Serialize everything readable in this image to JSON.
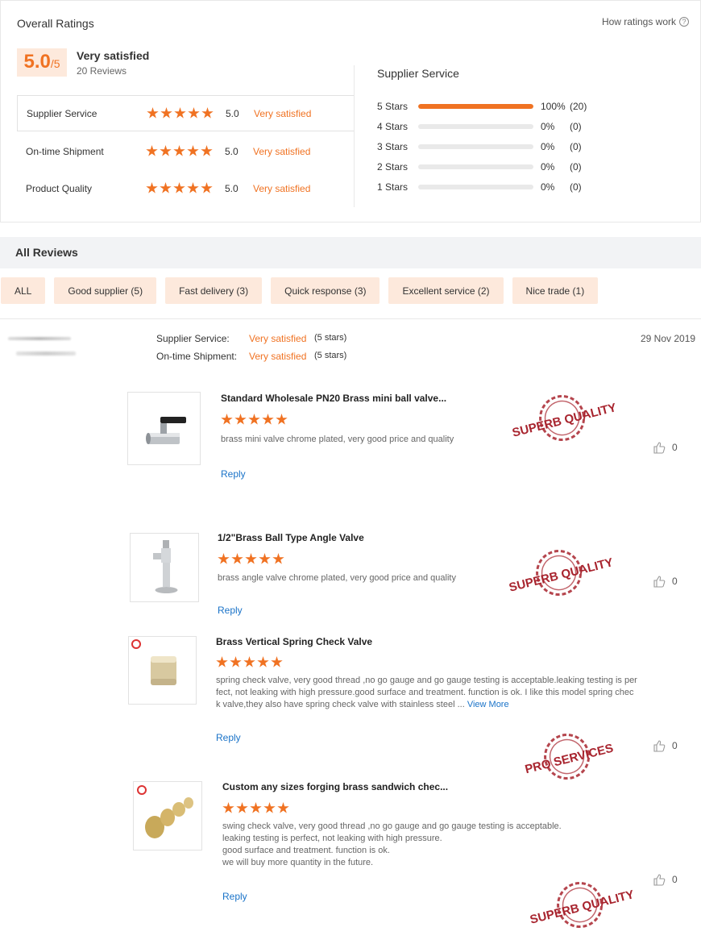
{
  "overall": {
    "title": "Overall Ratings",
    "how_link": "How ratings work",
    "score": "5.0",
    "score_denominator": "/5",
    "satisfaction": "Very satisfied",
    "reviews_count": "20 Reviews",
    "categories": [
      {
        "name": "Supplier Service",
        "stars": 5,
        "value": "5.0",
        "label": "Very satisfied"
      },
      {
        "name": "On-time Shipment",
        "stars": 5,
        "value": "5.0",
        "label": "Very satisfied"
      },
      {
        "name": "Product Quality",
        "stars": 5,
        "value": "5.0",
        "label": "Very satisfied"
      }
    ],
    "distribution": {
      "title": "Supplier Service",
      "rows": [
        {
          "label": "5  Stars",
          "fraction": 1.0,
          "pct": "100%",
          "count": "(20)"
        },
        {
          "label": "4  Stars",
          "fraction": 0,
          "pct": "0%",
          "count": "(0)"
        },
        {
          "label": "3  Stars",
          "fraction": 0,
          "pct": "0%",
          "count": "(0)"
        },
        {
          "label": "2  Stars",
          "fraction": 0,
          "pct": "0%",
          "count": "(0)"
        },
        {
          "label": "1  Stars",
          "fraction": 0,
          "pct": "0%",
          "count": "(0)"
        }
      ]
    }
  },
  "all_reviews": {
    "title": "All Reviews",
    "filters": [
      "ALL",
      "Good supplier (5)",
      "Fast delivery (3)",
      "Quick response (3)",
      "Excellent service (2)",
      "Nice trade (1)"
    ]
  },
  "review": {
    "date": "29 Nov 2019",
    "meta": [
      {
        "label": "Supplier Service:",
        "satisfaction": "Very satisfied",
        "stars": "(5 stars)"
      },
      {
        "label": "On-time Shipment:",
        "satisfaction": "Very satisfied",
        "stars": "(5 stars)"
      }
    ],
    "items": [
      {
        "title": "Standard Wholesale PN20 Brass mini ball valve...",
        "stars": 5,
        "text": "brass mini valve chrome plated, very good price and quality",
        "reply": "Reply",
        "likes": "0",
        "stamp": "SUPERB QUALITY"
      },
      {
        "title": "1/2\"Brass Ball Type Angle Valve",
        "stars": 5,
        "text": "brass angle valve chrome plated, very good price and quality",
        "reply": "Reply",
        "likes": "0",
        "stamp": "SUPERB QUALITY"
      },
      {
        "title": "Brass Vertical Spring Check Valve",
        "stars": 5,
        "text_lines": [
          "spring check valve, very good thread ,no go gauge and go gauge testing is acceptable.leaking testing is per",
          "fect, not leaking with high pressure.good surface and treatment. function is ok. I like this model spring chec",
          "k valve,they also have spring check valve with stainless steel ..."
        ],
        "view_more": "View More",
        "reply": "Reply",
        "likes": "0",
        "stamp": "PRO SERVICES"
      },
      {
        "title": "Custom any sizes forging brass sandwich chec...",
        "stars": 5,
        "text_lines": [
          "swing check valve, very good thread ,no go gauge and go gauge testing is acceptable.",
          "leaking testing is perfect, not leaking with high pressure.",
          "good surface and treatment. function is ok.",
          "we will buy more quantity in the future."
        ],
        "reply": "Reply",
        "likes": "0",
        "stamp": "SUPERB QUALITY"
      }
    ]
  },
  "colors": {
    "accent": "#f07222",
    "accent_light": "#fde9dc",
    "link": "#1a73c8",
    "stamp": "#a8242e"
  }
}
